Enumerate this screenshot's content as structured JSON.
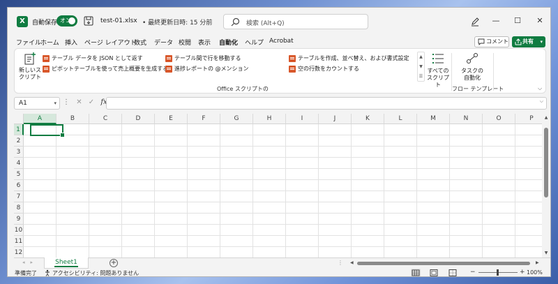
{
  "titlebar": {
    "app_icon": "excel-icon",
    "autosave_label": "自動保存",
    "autosave_toggle": "オン",
    "filename": "test-01.xlsx",
    "meta": "• 最終更新日時: 15 分前",
    "search_placeholder": "検索 (Alt+Q)",
    "minimize": "—",
    "maximize": "☐",
    "close": "✕"
  },
  "menu": {
    "items": [
      "ファイル",
      "ホーム",
      "挿入",
      "ページ レイアウト",
      "数式",
      "データ",
      "校閲",
      "表示",
      "自動化",
      "ヘルプ",
      "Acrobat"
    ],
    "active": "自動化",
    "comment_label": "コメント",
    "share_label": "共有"
  },
  "ribbon": {
    "new_script_line1": "新しいス",
    "new_script_line2": "クリプト",
    "gallery": [
      "テーブル データを JSON として返す",
      "テーブル間で行を移動する",
      "テーブルを作成、並べ替え、および書式設定",
      "ピボットテーブルを使って売上概要を生成する",
      "進捗レポートの @メンション",
      "空の行数をカウントする"
    ],
    "all_scripts_line1": "すべての",
    "all_scripts_line2": "スクリプト",
    "group_office_scripts": "Office スクリプトの",
    "task_auto_line1": "タスクの",
    "task_auto_line2": "自動化",
    "group_flow": "フロー テンプレート"
  },
  "formula_bar": {
    "name_box": "A1",
    "fx": "fx",
    "cancel": "✕",
    "enter": "✓",
    "value": ""
  },
  "grid": {
    "columns": [
      "A",
      "B",
      "C",
      "D",
      "E",
      "F",
      "G",
      "H",
      "I",
      "J",
      "K",
      "L",
      "M",
      "N",
      "O",
      "P"
    ],
    "rows": [
      "1",
      "2",
      "3",
      "4",
      "5",
      "6",
      "7",
      "8",
      "9",
      "10",
      "11",
      "12"
    ],
    "active_cell": "A1"
  },
  "sheets": {
    "tabs": [
      "Sheet1"
    ],
    "active": "Sheet1",
    "add_label": "+"
  },
  "statusbar": {
    "ready": "準備完了",
    "accessibility": "アクセシビリティ: 問題ありません",
    "zoom": "100%",
    "zoom_minus": "−",
    "zoom_plus": "+"
  },
  "colors": {
    "accent": "#107c41",
    "script_icon": "#d8572a"
  }
}
